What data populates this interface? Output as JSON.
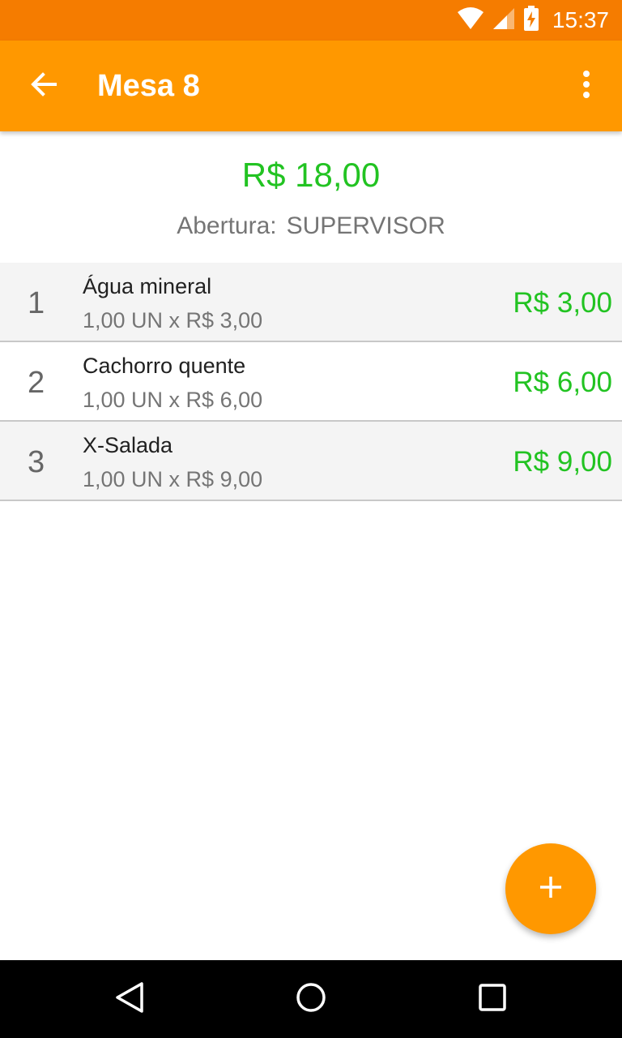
{
  "status_bar": {
    "time": "15:37",
    "icons": [
      "wifi-icon",
      "signal-icon",
      "battery-charging-icon"
    ]
  },
  "app_bar": {
    "title": "Mesa 8",
    "back_icon": "arrow-back-icon",
    "menu_icon": "more-vertical-icon"
  },
  "summary": {
    "total": "R$ 18,00",
    "opening_label": "Abertura:",
    "opening_user": "SUPERVISOR"
  },
  "items": [
    {
      "index": "1",
      "name": "Água mineral",
      "detail": "1,00 UN x R$ 3,00",
      "price": "R$ 3,00"
    },
    {
      "index": "2",
      "name": "Cachorro quente",
      "detail": "1,00 UN x R$ 6,00",
      "price": "R$ 6,00"
    },
    {
      "index": "3",
      "name": "X-Salada",
      "detail": "1,00 UN x R$ 9,00",
      "price": "R$ 9,00"
    }
  ],
  "fab": {
    "icon": "plus-icon"
  },
  "nav_bar": {
    "icons": [
      "back-triangle-icon",
      "home-circle-icon",
      "recents-square-icon"
    ]
  },
  "colors": {
    "status_bar": "#F57C00",
    "app_bar": "#FF9800",
    "accent_green": "#22C322",
    "row_shade": "#F4F4F4"
  }
}
